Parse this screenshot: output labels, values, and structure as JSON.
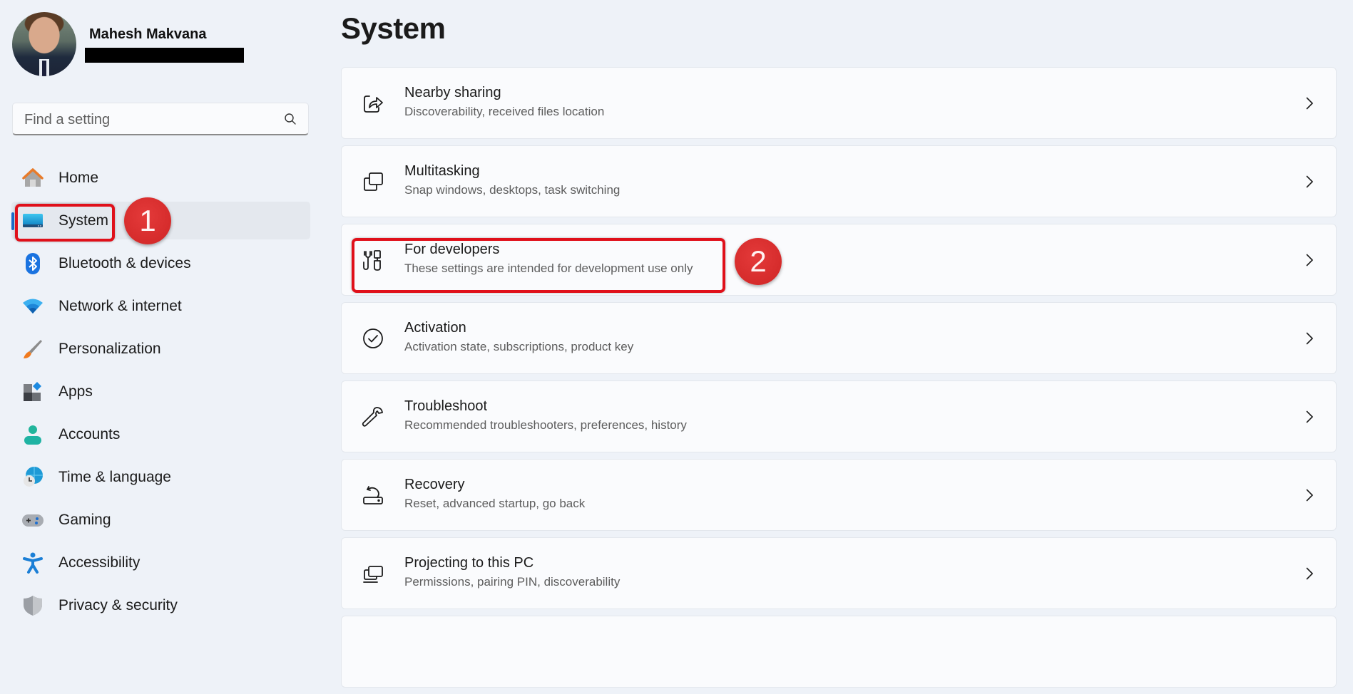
{
  "user": {
    "name": "Mahesh Makvana",
    "email_redacted": true
  },
  "search": {
    "placeholder": "Find a setting",
    "value": "",
    "icon": "search-icon"
  },
  "sidebar": {
    "items": [
      {
        "label": "Home",
        "icon": "home-icon",
        "selected": false
      },
      {
        "label": "System",
        "icon": "system-display-icon",
        "selected": true
      },
      {
        "label": "Bluetooth & devices",
        "icon": "bluetooth-icon",
        "selected": false
      },
      {
        "label": "Network & internet",
        "icon": "wifi-icon",
        "selected": false
      },
      {
        "label": "Personalization",
        "icon": "paintbrush-icon",
        "selected": false
      },
      {
        "label": "Apps",
        "icon": "apps-icon",
        "selected": false
      },
      {
        "label": "Accounts",
        "icon": "person-icon",
        "selected": false
      },
      {
        "label": "Time & language",
        "icon": "globe-clock-icon",
        "selected": false
      },
      {
        "label": "Gaming",
        "icon": "gamepad-icon",
        "selected": false
      },
      {
        "label": "Accessibility",
        "icon": "accessibility-icon",
        "selected": false
      },
      {
        "label": "Privacy & security",
        "icon": "shield-icon",
        "selected": false
      }
    ]
  },
  "main": {
    "title": "System",
    "cards": [
      {
        "title": "Nearby sharing",
        "subtitle": "Discoverability, received files location",
        "icon": "share-icon"
      },
      {
        "title": "Multitasking",
        "subtitle": "Snap windows, desktops, task switching",
        "icon": "multitasking-icon"
      },
      {
        "title": "For developers",
        "subtitle": "These settings are intended for development use only",
        "icon": "developer-tools-icon"
      },
      {
        "title": "Activation",
        "subtitle": "Activation state, subscriptions, product key",
        "icon": "check-circle-icon"
      },
      {
        "title": "Troubleshoot",
        "subtitle": "Recommended troubleshooters, preferences, history",
        "icon": "wrench-icon"
      },
      {
        "title": "Recovery",
        "subtitle": "Reset, advanced startup, go back",
        "icon": "recovery-icon"
      },
      {
        "title": "Projecting to this PC",
        "subtitle": "Permissions, pairing PIN, discoverability",
        "icon": "projecting-icon"
      }
    ]
  },
  "annotations": {
    "step1": "1",
    "step2": "2",
    "color": "#e0101a"
  }
}
